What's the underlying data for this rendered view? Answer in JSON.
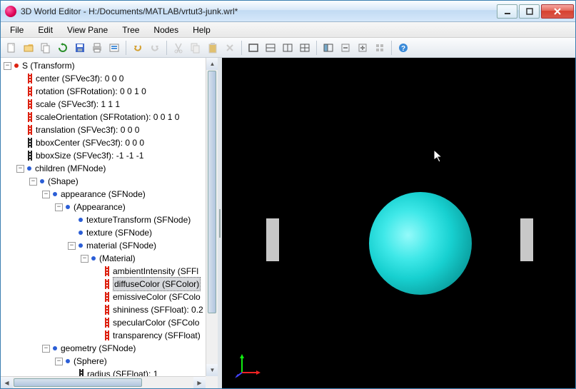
{
  "window": {
    "title": "3D World Editor - H:/Documents/MATLAB/vrtut3-junk.wrl*"
  },
  "menu": {
    "file": "File",
    "edit": "Edit",
    "viewpane": "View Pane",
    "tree": "Tree",
    "nodes": "Nodes",
    "help": "Help"
  },
  "tree": {
    "root": "S (Transform)",
    "center": "center (SFVec3f): 0  0  0",
    "rotation": "rotation (SFRotation): 0  0  1  0",
    "scale": "scale (SFVec3f): 1  1  1",
    "scaleOrientation": "scaleOrientation (SFRotation): 0  0  1  0",
    "translation": "translation (SFVec3f): 0  0  0",
    "bboxCenter": "bboxCenter (SFVec3f): 0  0  0",
    "bboxSize": "bboxSize (SFVec3f): -1 -1 -1",
    "children": "children (MFNode)",
    "shape": "(Shape)",
    "appearance": "appearance (SFNode)",
    "appearanceNode": "(Appearance)",
    "textureTransform": "textureTransform (SFNode)",
    "texture": "texture (SFNode)",
    "material": "material (SFNode)",
    "materialNode": "(Material)",
    "ambientIntensity": "ambientIntensity (SFFl",
    "diffuseColor": "diffuseColor (SFColor)",
    "emissiveColor": "emissiveColor (SFColo",
    "shininess": "shininess (SFFloat): 0.2",
    "specularColor": "specularColor (SFColo",
    "transparency": "transparency (SFFloat)",
    "geometry": "geometry (SFNode)",
    "sphere": "(Sphere)",
    "radius": "radius (SFFloat): 1"
  }
}
